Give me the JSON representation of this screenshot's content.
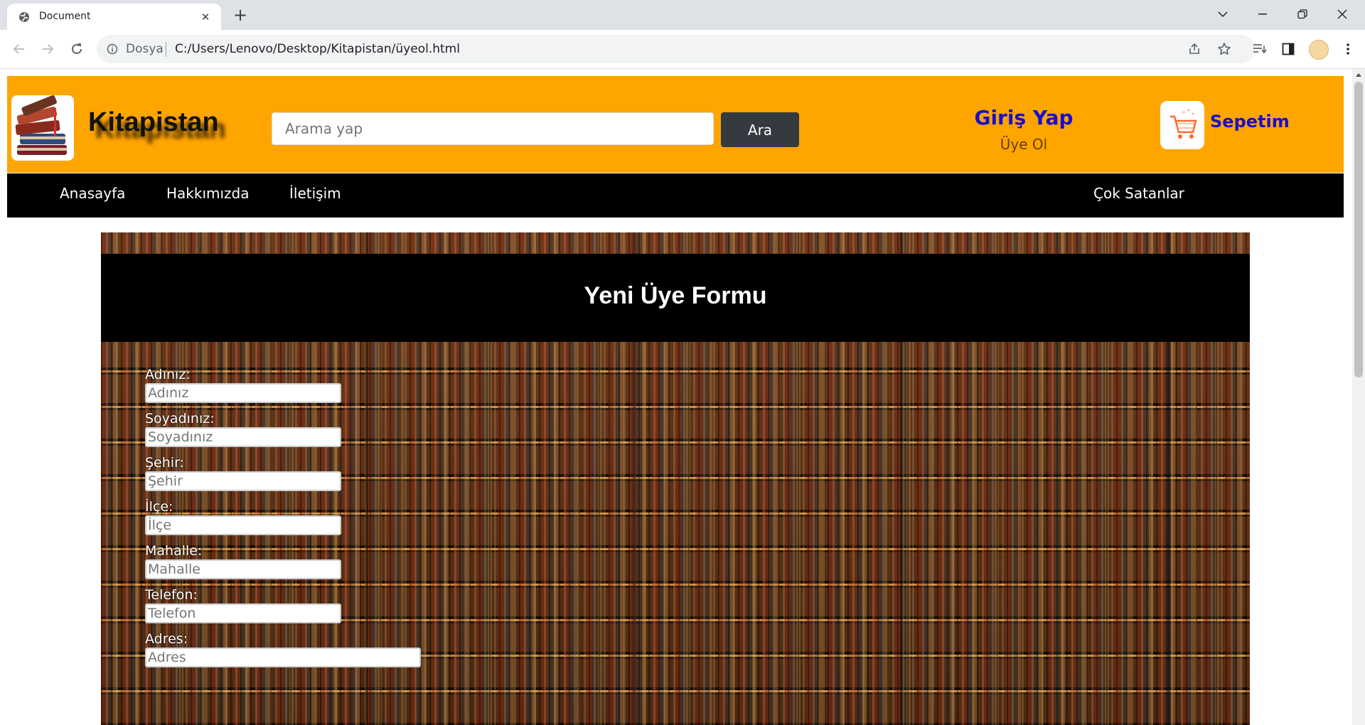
{
  "browser": {
    "tab_title": "Document",
    "tab_close": "✕",
    "new_tab": "+",
    "address_label": "Dosya",
    "url": "C:/Users/Lenovo/Desktop/Kitapistan/üyeol.html",
    "icons": [
      "back-icon",
      "forward-icon",
      "reload-icon",
      "info-icon",
      "share-icon",
      "star-icon",
      "reading-list-icon",
      "side-panel-icon",
      "profile-icon",
      "menu-icon",
      "minimize-icon",
      "restore-icon",
      "close-icon",
      "tab-search-icon"
    ]
  },
  "header": {
    "brand": "Kitapistan",
    "search_placeholder": "Arama yap",
    "search_button": "Ara",
    "login": "Giriş Yap",
    "signup": "Üye Ol",
    "cart": "Sepetim",
    "background_color": "#ffa500",
    "link_color": "#1a0dcc"
  },
  "nav": {
    "items": [
      "Anasayfa",
      "Hakkımızda",
      "İletişim"
    ],
    "right_item": "Çok Satanlar"
  },
  "form": {
    "title": "Yeni Üye Formu",
    "fields": [
      {
        "label": "Adınız:",
        "placeholder": "Adınız"
      },
      {
        "label": "Soyadınız:",
        "placeholder": "Soyadınız"
      },
      {
        "label": "Şehir:",
        "placeholder": "Şehir"
      },
      {
        "label": "İlçe:",
        "placeholder": "İlçe"
      },
      {
        "label": "Mahalle:",
        "placeholder": "Mahalle"
      },
      {
        "label": "Telefon:",
        "placeholder": "Telefon"
      },
      {
        "label": "Adres:",
        "placeholder": "Adres"
      }
    ]
  }
}
